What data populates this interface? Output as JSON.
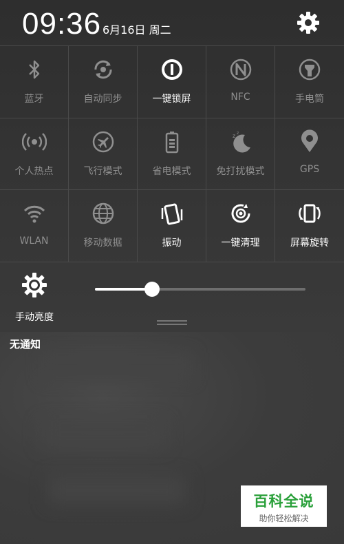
{
  "status": {
    "time": "09:36",
    "date": "6月16日 周二"
  },
  "tiles": [
    {
      "label": "蓝牙",
      "icon": "bluetooth-icon",
      "on": false
    },
    {
      "label": "自动同步",
      "icon": "sync-icon",
      "on": false
    },
    {
      "label": "一键锁屏",
      "icon": "lock-screen-icon",
      "on": true
    },
    {
      "label": "NFC",
      "icon": "nfc-icon",
      "on": false
    },
    {
      "label": "手电筒",
      "icon": "flashlight-icon",
      "on": false
    },
    {
      "label": "个人热点",
      "icon": "hotspot-icon",
      "on": false
    },
    {
      "label": "飞行模式",
      "icon": "airplane-icon",
      "on": false
    },
    {
      "label": "省电模式",
      "icon": "battery-icon",
      "on": false
    },
    {
      "label": "免打扰模式",
      "icon": "moon-icon",
      "on": false
    },
    {
      "label": "GPS",
      "icon": "location-pin-icon",
      "on": false
    },
    {
      "label": "WLAN",
      "icon": "wifi-icon",
      "on": false
    },
    {
      "label": "移动数据",
      "icon": "globe-icon",
      "on": false
    },
    {
      "label": "振动",
      "icon": "vibrate-icon",
      "on": true
    },
    {
      "label": "一键清理",
      "icon": "cleanup-icon",
      "on": true
    },
    {
      "label": "屏幕旋转",
      "icon": "rotate-icon",
      "on": true
    }
  ],
  "brightness": {
    "label": "手动亮度",
    "level": 0.27
  },
  "notifications": {
    "empty_text": "无通知"
  },
  "watermark": {
    "title": "百科全说",
    "subtitle": "助你轻松解决",
    "color": "#2aa03a"
  }
}
